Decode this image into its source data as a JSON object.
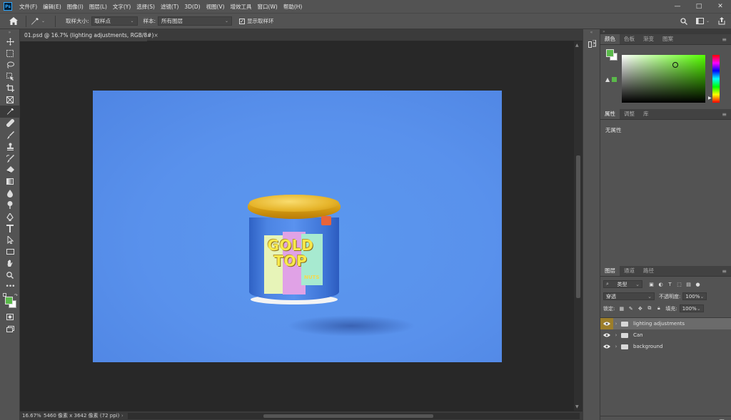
{
  "app": {
    "logo": "Ps"
  },
  "menu": [
    "文件(F)",
    "编辑(E)",
    "图像(I)",
    "图层(L)",
    "文字(Y)",
    "选择(S)",
    "滤镜(T)",
    "3D(D)",
    "视图(V)",
    "增效工具",
    "窗口(W)",
    "帮助(H)"
  ],
  "window_controls": {
    "minimize": "—",
    "maximize": "□",
    "close": "✕"
  },
  "options": {
    "sample_size_label": "取样大小:",
    "sample_size_value": "取样点",
    "sample_label": "样本:",
    "sample_value": "所有图层",
    "show_ring_label": "显示取样环",
    "show_ring_checked": "✓"
  },
  "document": {
    "tab_title": "01.psd @ 16.7% (lighting adjustments, RGB/8#)",
    "tab_close": "×",
    "canvas_color": "#5a95ed",
    "product": {
      "line1": "GOLD",
      "line2": "TOP",
      "sub": "NUTS"
    }
  },
  "status": {
    "zoom": "16.67%",
    "dimensions": "5460 像素 x 3642 像素 (72 ppi)",
    "arrow": "›"
  },
  "color_panel": {
    "tabs": [
      "颜色",
      "色板",
      "渐变",
      "图案"
    ],
    "active_tab": 0,
    "foreground": "#5ab94a",
    "background": "#ffffff"
  },
  "properties_panel": {
    "tabs": [
      "属性",
      "调整",
      "库"
    ],
    "active_tab": 0,
    "empty_text": "无属性"
  },
  "layers_panel": {
    "tabs": [
      "图层",
      "通道",
      "路径"
    ],
    "active_tab": 0,
    "filter_kind": "类型",
    "blend_mode": "穿透",
    "opacity_label": "不透明度:",
    "opacity_value": "100%",
    "lock_label": "锁定:",
    "fill_label": "填充:",
    "fill_value": "100%",
    "layers": [
      {
        "name": "lighting adjustments",
        "selected": true
      },
      {
        "name": "Can",
        "selected": false
      },
      {
        "name": "background",
        "selected": false
      }
    ],
    "footer_icons": [
      "link-icon",
      "fx-icon",
      "mask-icon",
      "adjustment-icon",
      "group-icon",
      "new-layer-icon",
      "trash-icon"
    ]
  }
}
